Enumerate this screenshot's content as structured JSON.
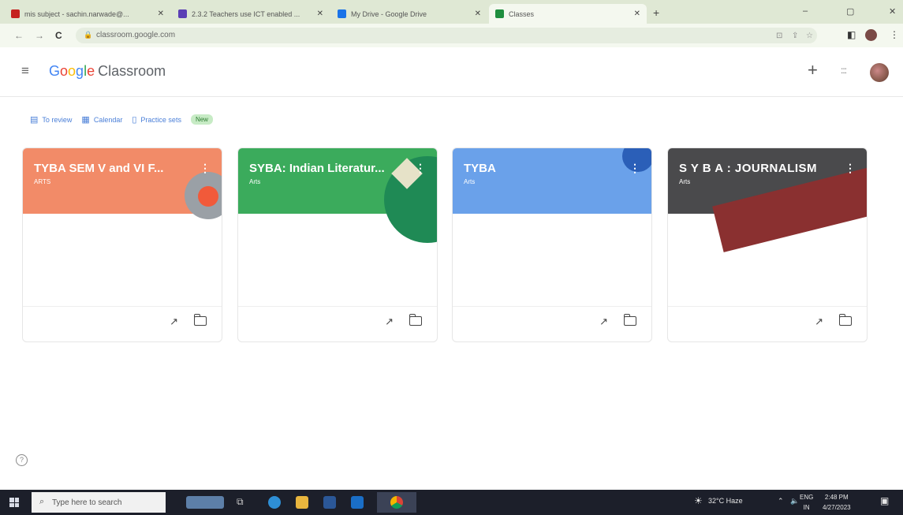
{
  "browser": {
    "tabs": [
      {
        "title": "mis subject - sachin.narwade@...",
        "fav_color": "#c5221f"
      },
      {
        "title": "2.3.2 Teachers use ICT enabled ...",
        "fav_color": "#5b3fb5"
      },
      {
        "title": "My Drive - Google Drive",
        "fav_color": "#1a73e8"
      },
      {
        "title": "Classes",
        "fav_color": "#1e8e3e"
      }
    ],
    "new_tab": "+",
    "window_controls": {
      "minimize": "–",
      "maximize": "▢",
      "close": "✕"
    },
    "nav": {
      "back": "←",
      "forward": "→",
      "reload": "C"
    },
    "url": "classroom.google.com"
  },
  "app": {
    "logo_parts": [
      "G",
      "o",
      "o",
      "g",
      "l",
      "e"
    ],
    "product": "Classroom",
    "menu_icon": "≡",
    "plus": "+",
    "apps_icon": ":::"
  },
  "subnav": {
    "to_review": "To review",
    "calendar": "Calendar",
    "practice_sets": "Practice sets",
    "new_badge": "New"
  },
  "classes": [
    {
      "name": "TYBA SEM V and VI F...",
      "section": "ARTS",
      "color": "#f28b68"
    },
    {
      "name": "SYBA: Indian Literatur...",
      "section": "Arts",
      "color": "#3bab5c"
    },
    {
      "name": "TYBA",
      "section": "Arts",
      "color": "#6aa1ea"
    },
    {
      "name": "S Y B A : JOURNALISM",
      "section": "Arts",
      "color": "#4a4a4c"
    }
  ],
  "card_icons": {
    "trend": "↗",
    "kebab": "⋮"
  },
  "help": "?",
  "taskbar": {
    "search_placeholder": "Type here to search",
    "weather": "32°C Haze",
    "lang_line1": "ENG",
    "lang_line2": "IN",
    "time": "2:48 PM",
    "date": "4/27/2023"
  }
}
